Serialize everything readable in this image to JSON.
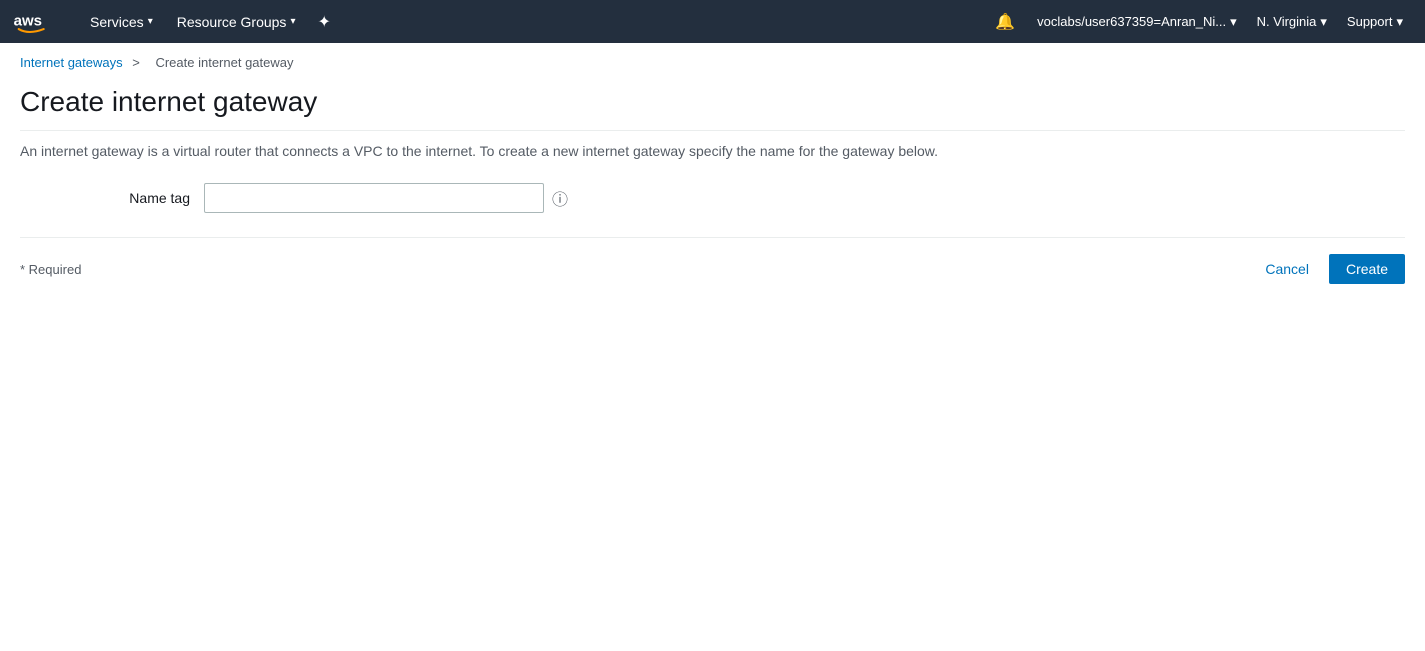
{
  "nav": {
    "services_label": "Services",
    "resource_groups_label": "Resource Groups",
    "bell_icon": "🔔",
    "pin_icon": "⊞",
    "user_label": "voclabs/user637359=Anran_Ni...",
    "region_label": "N. Virginia",
    "support_label": "Support"
  },
  "breadcrumb": {
    "link_text": "Internet gateways",
    "separator": ">",
    "current": "Create internet gateway"
  },
  "page": {
    "title": "Create internet gateway",
    "description": "An internet gateway is a virtual router that connects a VPC to the internet. To create a new internet gateway specify the name for the gateway below."
  },
  "form": {
    "name_tag_label": "Name tag",
    "name_tag_value": "",
    "required_note": "* Required"
  },
  "buttons": {
    "cancel_label": "Cancel",
    "create_label": "Create"
  }
}
